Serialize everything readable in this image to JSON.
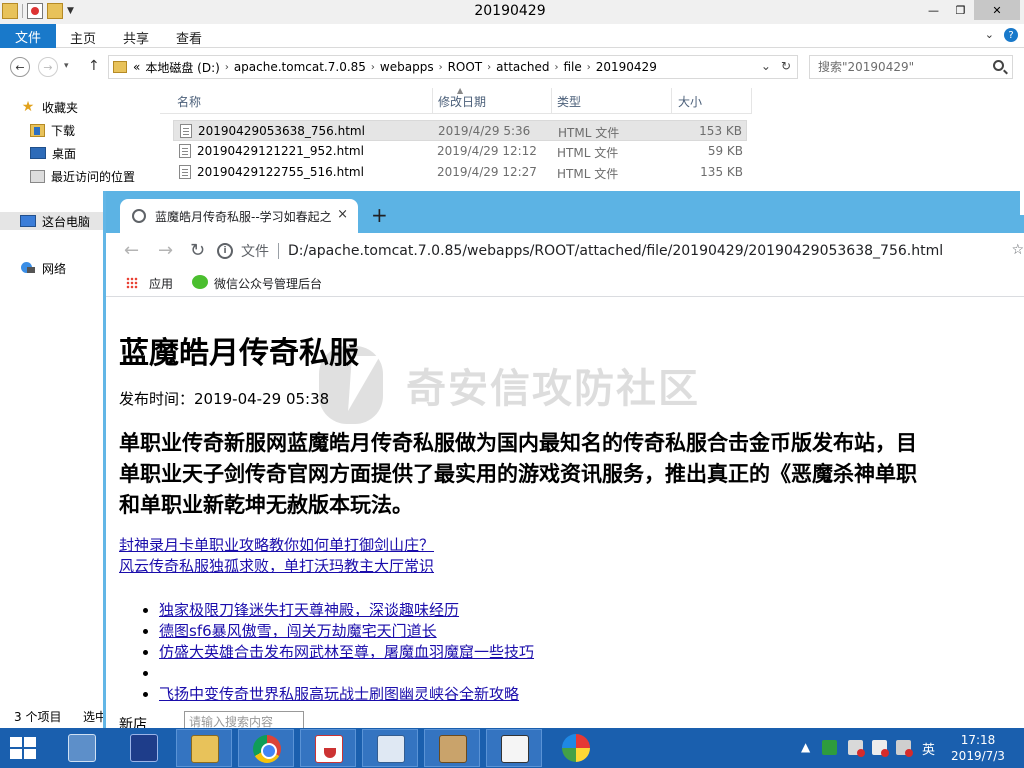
{
  "explorer": {
    "title": "20190429",
    "ribbon": {
      "file": "文件",
      "home": "主页",
      "share": "共享",
      "view": "查看"
    },
    "breadcrumb": [
      "«",
      "本地磁盘 (D:)",
      "apache.tomcat.7.0.85",
      "webapps",
      "ROOT",
      "attached",
      "file",
      "20190429"
    ],
    "search_placeholder": "搜索\"20190429\"",
    "nav": {
      "favorites": "收藏夹",
      "downloads": "下载",
      "desktop": "桌面",
      "recent": "最近访问的位置",
      "this_pc": "这台电脑",
      "network": "网络"
    },
    "columns": {
      "name": "名称",
      "date": "修改日期",
      "type": "类型",
      "size": "大小"
    },
    "files": [
      {
        "name": "20190429053638_756.html",
        "date": "2019/4/29 5:36",
        "type": "HTML 文件",
        "size": "153 KB"
      },
      {
        "name": "20190429121221_952.html",
        "date": "2019/4/29 12:12",
        "type": "HTML 文件",
        "size": "59 KB"
      },
      {
        "name": "20190429122755_516.html",
        "date": "2019/4/29 12:27",
        "type": "HTML 文件",
        "size": "135 KB"
      }
    ],
    "status": {
      "count": "3 个项目",
      "selected": "选中"
    }
  },
  "chrome": {
    "tab_title": "蓝魔皓月传奇私服--学习如春起之苗",
    "tab_close": "×",
    "new_tab": "+",
    "scheme_label": "文件",
    "url": "D:/apache.tomcat.7.0.85/webapps/ROOT/attached/file/20190429/20190429053638_756.html",
    "bookmarks": {
      "apps": "应用",
      "wechat": "微信公众号管理后台"
    }
  },
  "page": {
    "title": "蓝魔皓月传奇私服",
    "publish_time": "发布时间：2019-04-29 05:38",
    "lead_lines": [
      "单职业传奇新服网蓝魔皓月传奇私服做为国内最知名的传奇私服合击金币版发布站，目",
      "单职业天子剑传奇官网方面提供了最实用的游戏资讯服务，推出真正的《恶魔杀神单职",
      "和单职业新乾坤无赦版本玩法。"
    ],
    "links": [
      "封神录月卡单职业攻略教你如何单打御剑山庄？",
      "风云传奇私服独孤求败，单打沃玛教主大厅常识"
    ],
    "list_items": [
      "独家极限刀锋迷失打天尊神殿，深谈趣味经历",
      "德图sf6暴风傲雪，闯关万劫魔宅天门道长",
      "仿盛大英雄合击发布网武林至尊，屠魔血羽魔窟一些技巧",
      "",
      "飞扬中变传奇世界私服高玩战士刷图幽灵峡谷全新攻略"
    ],
    "bottom_label": "新店",
    "bottom_input_value": "请输入搜索内容",
    "watermark": "奇安信攻防社区"
  },
  "taskbar": {
    "language": "英",
    "time": "17:18",
    "date": "2019/7/3"
  }
}
